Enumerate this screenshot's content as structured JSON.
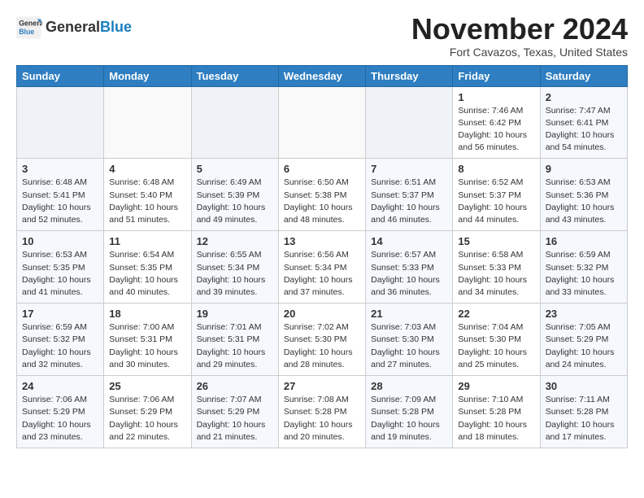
{
  "header": {
    "logo_line1": "General",
    "logo_line2": "Blue",
    "month_title": "November 2024",
    "location": "Fort Cavazos, Texas, United States"
  },
  "weekdays": [
    "Sunday",
    "Monday",
    "Tuesday",
    "Wednesday",
    "Thursday",
    "Friday",
    "Saturday"
  ],
  "weeks": [
    [
      {
        "day": "",
        "text": ""
      },
      {
        "day": "",
        "text": ""
      },
      {
        "day": "",
        "text": ""
      },
      {
        "day": "",
        "text": ""
      },
      {
        "day": "",
        "text": ""
      },
      {
        "day": "1",
        "text": "Sunrise: 7:46 AM\nSunset: 6:42 PM\nDaylight: 10 hours and 56 minutes."
      },
      {
        "day": "2",
        "text": "Sunrise: 7:47 AM\nSunset: 6:41 PM\nDaylight: 10 hours and 54 minutes."
      }
    ],
    [
      {
        "day": "3",
        "text": "Sunrise: 6:48 AM\nSunset: 5:41 PM\nDaylight: 10 hours and 52 minutes."
      },
      {
        "day": "4",
        "text": "Sunrise: 6:48 AM\nSunset: 5:40 PM\nDaylight: 10 hours and 51 minutes."
      },
      {
        "day": "5",
        "text": "Sunrise: 6:49 AM\nSunset: 5:39 PM\nDaylight: 10 hours and 49 minutes."
      },
      {
        "day": "6",
        "text": "Sunrise: 6:50 AM\nSunset: 5:38 PM\nDaylight: 10 hours and 48 minutes."
      },
      {
        "day": "7",
        "text": "Sunrise: 6:51 AM\nSunset: 5:37 PM\nDaylight: 10 hours and 46 minutes."
      },
      {
        "day": "8",
        "text": "Sunrise: 6:52 AM\nSunset: 5:37 PM\nDaylight: 10 hours and 44 minutes."
      },
      {
        "day": "9",
        "text": "Sunrise: 6:53 AM\nSunset: 5:36 PM\nDaylight: 10 hours and 43 minutes."
      }
    ],
    [
      {
        "day": "10",
        "text": "Sunrise: 6:53 AM\nSunset: 5:35 PM\nDaylight: 10 hours and 41 minutes."
      },
      {
        "day": "11",
        "text": "Sunrise: 6:54 AM\nSunset: 5:35 PM\nDaylight: 10 hours and 40 minutes."
      },
      {
        "day": "12",
        "text": "Sunrise: 6:55 AM\nSunset: 5:34 PM\nDaylight: 10 hours and 39 minutes."
      },
      {
        "day": "13",
        "text": "Sunrise: 6:56 AM\nSunset: 5:34 PM\nDaylight: 10 hours and 37 minutes."
      },
      {
        "day": "14",
        "text": "Sunrise: 6:57 AM\nSunset: 5:33 PM\nDaylight: 10 hours and 36 minutes."
      },
      {
        "day": "15",
        "text": "Sunrise: 6:58 AM\nSunset: 5:33 PM\nDaylight: 10 hours and 34 minutes."
      },
      {
        "day": "16",
        "text": "Sunrise: 6:59 AM\nSunset: 5:32 PM\nDaylight: 10 hours and 33 minutes."
      }
    ],
    [
      {
        "day": "17",
        "text": "Sunrise: 6:59 AM\nSunset: 5:32 PM\nDaylight: 10 hours and 32 minutes."
      },
      {
        "day": "18",
        "text": "Sunrise: 7:00 AM\nSunset: 5:31 PM\nDaylight: 10 hours and 30 minutes."
      },
      {
        "day": "19",
        "text": "Sunrise: 7:01 AM\nSunset: 5:31 PM\nDaylight: 10 hours and 29 minutes."
      },
      {
        "day": "20",
        "text": "Sunrise: 7:02 AM\nSunset: 5:30 PM\nDaylight: 10 hours and 28 minutes."
      },
      {
        "day": "21",
        "text": "Sunrise: 7:03 AM\nSunset: 5:30 PM\nDaylight: 10 hours and 27 minutes."
      },
      {
        "day": "22",
        "text": "Sunrise: 7:04 AM\nSunset: 5:30 PM\nDaylight: 10 hours and 25 minutes."
      },
      {
        "day": "23",
        "text": "Sunrise: 7:05 AM\nSunset: 5:29 PM\nDaylight: 10 hours and 24 minutes."
      }
    ],
    [
      {
        "day": "24",
        "text": "Sunrise: 7:06 AM\nSunset: 5:29 PM\nDaylight: 10 hours and 23 minutes."
      },
      {
        "day": "25",
        "text": "Sunrise: 7:06 AM\nSunset: 5:29 PM\nDaylight: 10 hours and 22 minutes."
      },
      {
        "day": "26",
        "text": "Sunrise: 7:07 AM\nSunset: 5:29 PM\nDaylight: 10 hours and 21 minutes."
      },
      {
        "day": "27",
        "text": "Sunrise: 7:08 AM\nSunset: 5:28 PM\nDaylight: 10 hours and 20 minutes."
      },
      {
        "day": "28",
        "text": "Sunrise: 7:09 AM\nSunset: 5:28 PM\nDaylight: 10 hours and 19 minutes."
      },
      {
        "day": "29",
        "text": "Sunrise: 7:10 AM\nSunset: 5:28 PM\nDaylight: 10 hours and 18 minutes."
      },
      {
        "day": "30",
        "text": "Sunrise: 7:11 AM\nSunset: 5:28 PM\nDaylight: 10 hours and 17 minutes."
      }
    ]
  ]
}
